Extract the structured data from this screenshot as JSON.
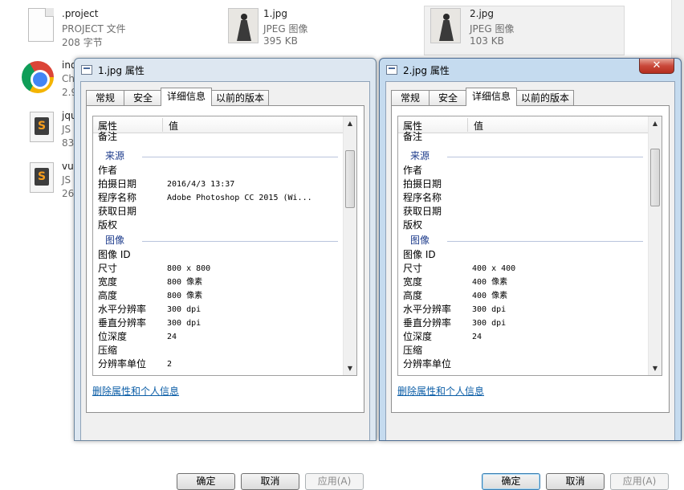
{
  "explorer": {
    "files": [
      {
        "name": ".project",
        "type": "PROJECT 文件",
        "size": "208 字节",
        "icon": "document-icon"
      },
      {
        "name": "1.jpg",
        "type": "JPEG 图像",
        "size": "395 KB",
        "icon": "photo-thumbnail-icon"
      },
      {
        "name": "2.jpg",
        "type": "JPEG 图像",
        "size": "103 KB",
        "icon": "photo-thumbnail-icon"
      },
      {
        "name": "ind",
        "type": "Ch",
        "size": "2.9",
        "icon": "chrome-icon"
      },
      {
        "name": "jqu",
        "type": "JS",
        "size": "83",
        "icon": "sublime-text-icon"
      },
      {
        "name": "vu",
        "type": "JS",
        "size": "26",
        "icon": "sublime-text-icon"
      }
    ]
  },
  "common": {
    "tabs": [
      "常规",
      "安全",
      "详细信息",
      "以前的版本"
    ],
    "col_property": "属性",
    "col_value": "值",
    "remove_link": "删除属性和个人信息",
    "ok": "确定",
    "cancel": "取消",
    "apply": "应用(A)",
    "close_glyph": "✕",
    "scroll_up_glyph": "▲",
    "scroll_down_glyph": "▼"
  },
  "dialog1": {
    "title": "1.jpg 属性",
    "rows": [
      {
        "kind": "row",
        "label": "备注",
        "value": ""
      },
      {
        "kind": "group",
        "label": "来源"
      },
      {
        "kind": "row",
        "label": "作者",
        "value": ""
      },
      {
        "kind": "row",
        "label": "拍摄日期",
        "value": "2016/4/3 13:37"
      },
      {
        "kind": "row",
        "label": "程序名称",
        "value": "Adobe Photoshop CC 2015 (Wi..."
      },
      {
        "kind": "row",
        "label": "获取日期",
        "value": ""
      },
      {
        "kind": "row",
        "label": "版权",
        "value": ""
      },
      {
        "kind": "group",
        "label": "图像"
      },
      {
        "kind": "row",
        "label": "图像 ID",
        "value": ""
      },
      {
        "kind": "row",
        "label": "尺寸",
        "value": "800 x 800"
      },
      {
        "kind": "row",
        "label": "宽度",
        "value": "800 像素"
      },
      {
        "kind": "row",
        "label": "高度",
        "value": "800 像素"
      },
      {
        "kind": "row",
        "label": "水平分辨率",
        "value": "300 dpi"
      },
      {
        "kind": "row",
        "label": "垂直分辨率",
        "value": "300 dpi"
      },
      {
        "kind": "row",
        "label": "位深度",
        "value": "24"
      },
      {
        "kind": "row",
        "label": "压缩",
        "value": ""
      },
      {
        "kind": "row",
        "label": "分辨率单位",
        "value": "2"
      }
    ]
  },
  "dialog2": {
    "title": "2.jpg 属性",
    "rows": [
      {
        "kind": "row",
        "label": "备注",
        "value": ""
      },
      {
        "kind": "group",
        "label": "来源"
      },
      {
        "kind": "row",
        "label": "作者",
        "value": ""
      },
      {
        "kind": "row",
        "label": "拍摄日期",
        "value": ""
      },
      {
        "kind": "row",
        "label": "程序名称",
        "value": ""
      },
      {
        "kind": "row",
        "label": "获取日期",
        "value": ""
      },
      {
        "kind": "row",
        "label": "版权",
        "value": ""
      },
      {
        "kind": "group",
        "label": "图像"
      },
      {
        "kind": "row",
        "label": "图像 ID",
        "value": ""
      },
      {
        "kind": "row",
        "label": "尺寸",
        "value": "400 x 400"
      },
      {
        "kind": "row",
        "label": "宽度",
        "value": "400 像素"
      },
      {
        "kind": "row",
        "label": "高度",
        "value": "400 像素"
      },
      {
        "kind": "row",
        "label": "水平分辨率",
        "value": "300 dpi"
      },
      {
        "kind": "row",
        "label": "垂直分辨率",
        "value": "300 dpi"
      },
      {
        "kind": "row",
        "label": "位深度",
        "value": "24"
      },
      {
        "kind": "row",
        "label": "压缩",
        "value": ""
      },
      {
        "kind": "row",
        "label": "分辨率单位",
        "value": ""
      }
    ]
  },
  "colors": {
    "link": "#0c5ea7",
    "group_header": "#1e3c8c",
    "active_frame": "#c5dbef",
    "inactive_frame": "#dde7f1"
  }
}
